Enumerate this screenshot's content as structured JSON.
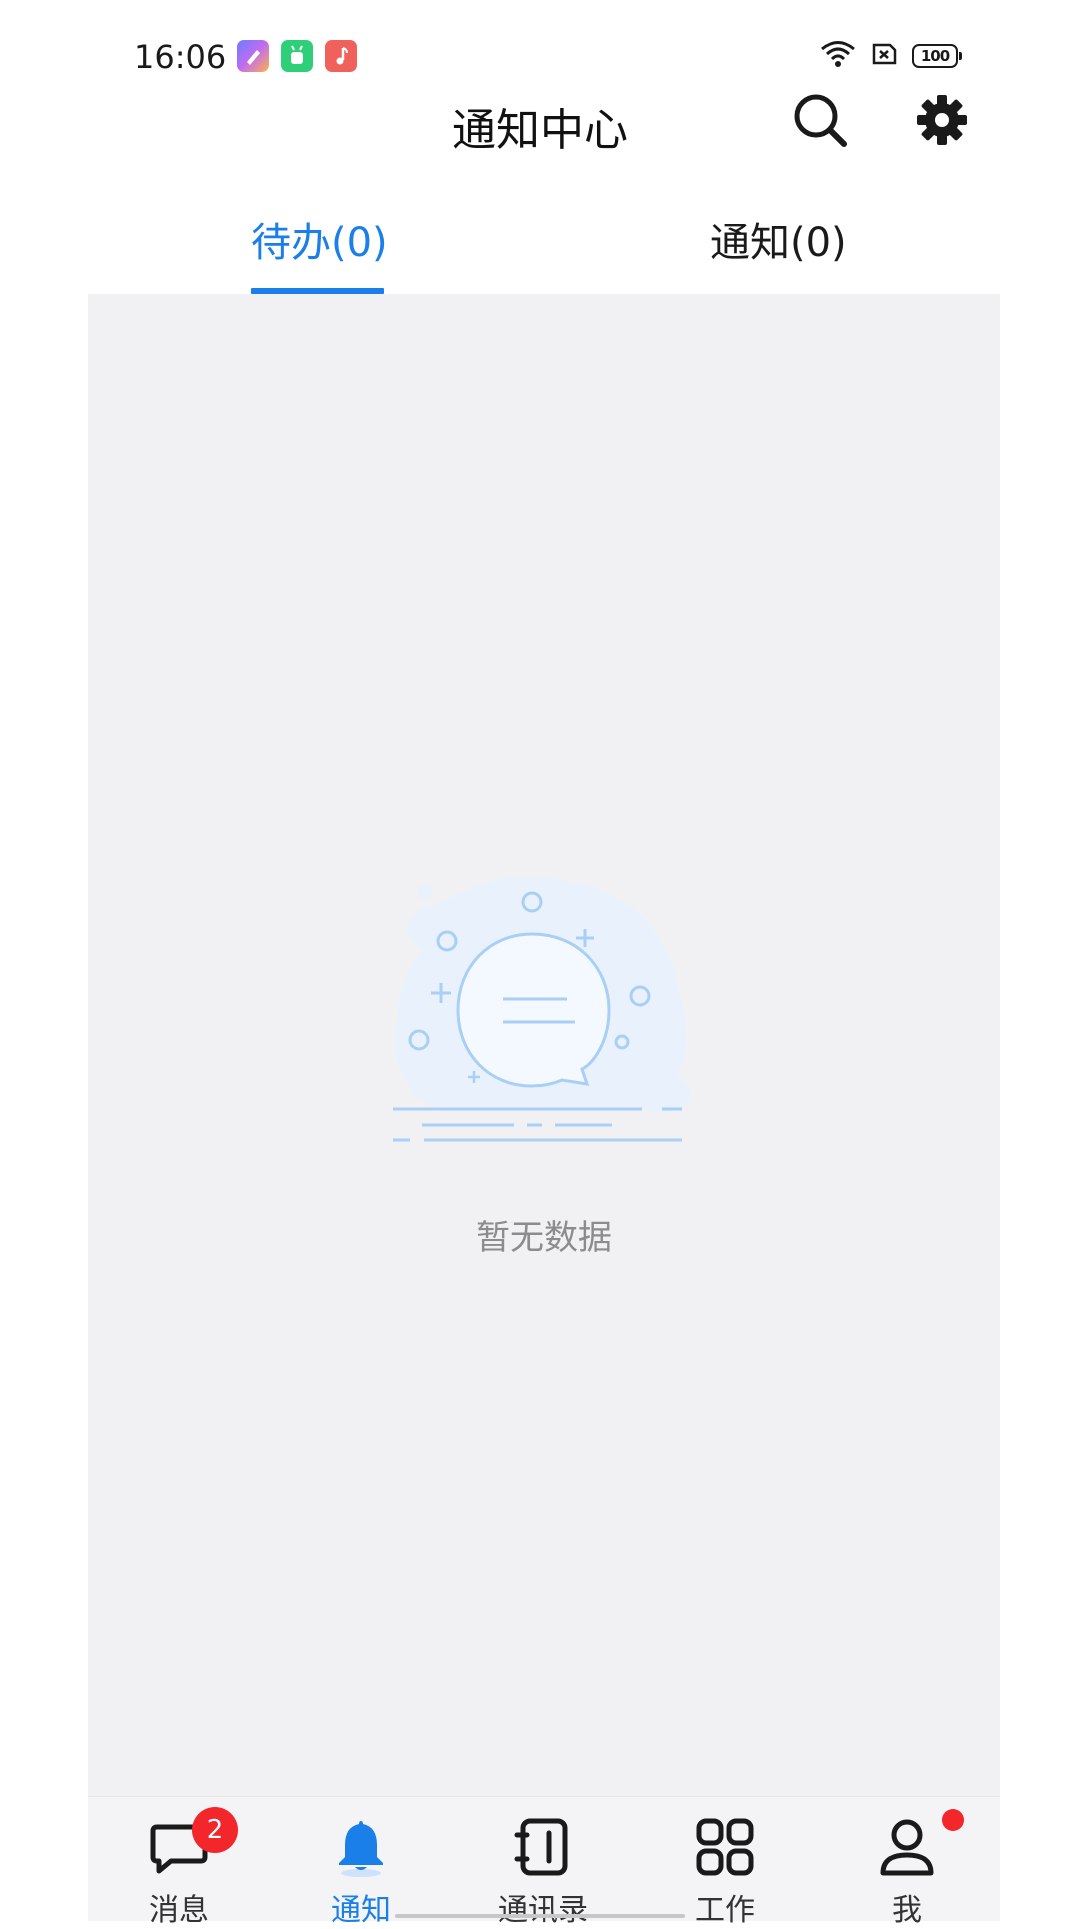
{
  "status_bar": {
    "time": "16:06",
    "battery": "100",
    "notification_icons": [
      "pen-app-icon",
      "android-app-icon",
      "music-app-icon"
    ],
    "system_icons": [
      "wifi-icon",
      "sim-off-icon",
      "battery-icon"
    ]
  },
  "header": {
    "title": "通知中心",
    "actions": [
      "search-icon",
      "gear-icon"
    ]
  },
  "tabs": [
    {
      "label": "待办(0)",
      "active": true
    },
    {
      "label": "通知(0)",
      "active": false
    }
  ],
  "empty_state": {
    "text": "暂无数据",
    "icon": "empty-chat-bubble-illustration"
  },
  "bottom_nav": [
    {
      "label": "消息",
      "icon": "chat-bubble-icon",
      "badge": "2",
      "active": false
    },
    {
      "label": "通知",
      "icon": "bell-icon",
      "active": true
    },
    {
      "label": "通讯录",
      "icon": "contacts-book-icon",
      "active": false
    },
    {
      "label": "工作",
      "icon": "grid-icon",
      "active": false
    },
    {
      "label": "我",
      "icon": "person-icon",
      "dot": true,
      "active": false
    }
  ],
  "colors": {
    "accent": "#1a7fe8",
    "badge": "#f2262b",
    "content_bg": "#f1f1f3",
    "empty_text": "#8c8c8c"
  }
}
